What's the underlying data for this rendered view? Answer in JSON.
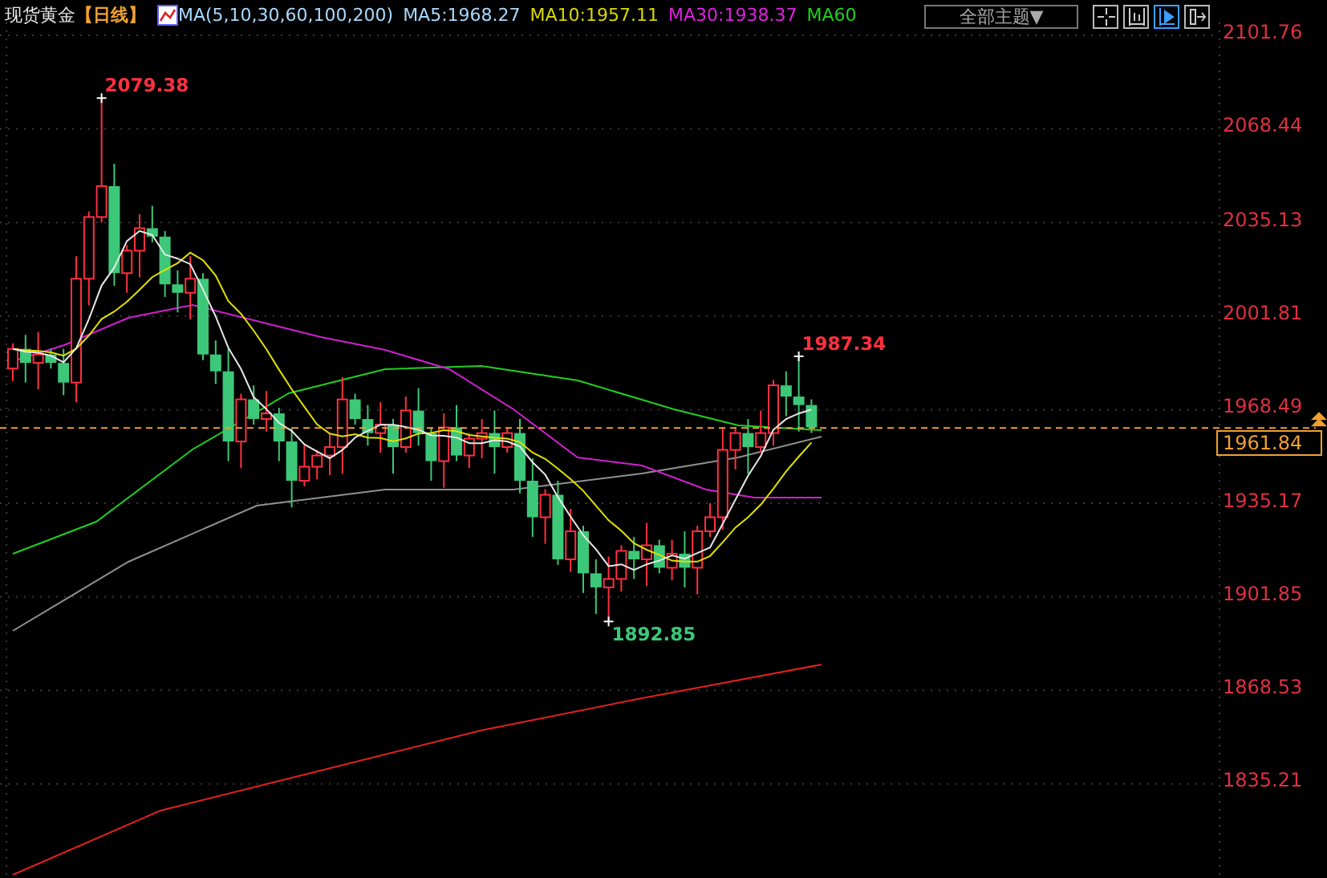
{
  "header": {
    "instrument": "现货黄金",
    "period": "【日线】",
    "indicator": "MA(5,10,30,60,100,200)",
    "legend": [
      {
        "label": "MA5:1968.27",
        "color": "#a8d8ff"
      },
      {
        "label": "MA10:1957.11",
        "color": "#d8d800"
      },
      {
        "label": "MA30:1938.37",
        "color": "#e020e0"
      },
      {
        "label": "MA60",
        "color": "#20d020"
      }
    ]
  },
  "theme_dropdown": {
    "label": "全部主题▼"
  },
  "toolbar": [
    {
      "kind": "crosshair",
      "selected": false
    },
    {
      "kind": "range",
      "selected": false
    },
    {
      "kind": "play",
      "selected": true
    },
    {
      "kind": "exit",
      "selected": false
    }
  ],
  "price_axis": {
    "labels": [
      "2101.76",
      "2068.44",
      "2035.13",
      "2001.81",
      "1968.49",
      "1935.17",
      "1901.85",
      "1868.53",
      "1835.21"
    ]
  },
  "current_price": "1961.84",
  "annotations": [
    {
      "label": "2079.38",
      "kind": "high"
    },
    {
      "label": "1892.85",
      "kind": "low"
    },
    {
      "label": "1987.34",
      "kind": "high"
    }
  ]
}
